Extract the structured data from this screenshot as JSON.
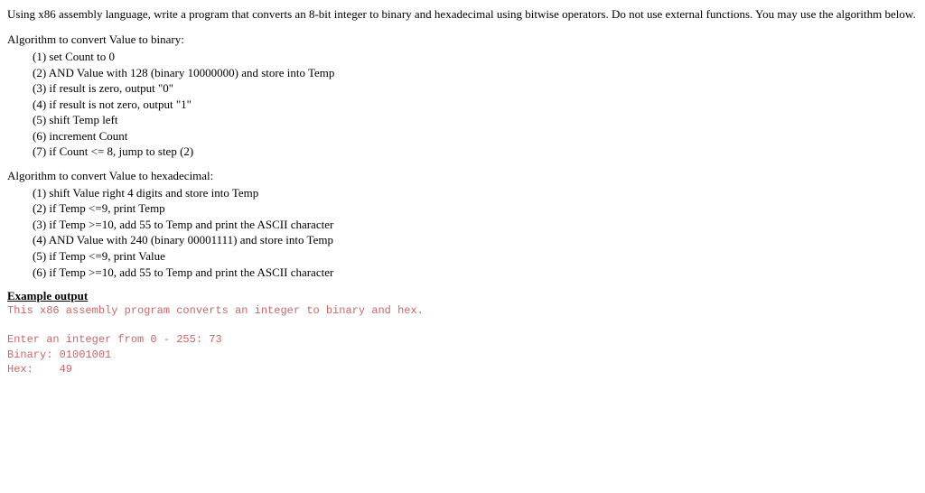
{
  "intro": "Using x86 assembly language, write a program that converts an 8-bit integer to binary and hexadecimal using bitwise operators.  Do not use external functions.  You may use the algorithm below.",
  "binary_algo_title": "Algorithm to convert Value to binary:",
  "binary_steps": [
    "(1)  set Count to 0",
    "(2)  AND Value with 128 (binary 10000000) and store into Temp",
    "(3)  if result is zero, output \"0\"",
    "(4)  if result is not zero, output \"1\"",
    "(5)  shift Temp left",
    "(6)  increment Count",
    "(7)  if Count <= 8, jump to step (2)"
  ],
  "hex_algo_title": "Algorithm to convert Value to hexadecimal:",
  "hex_steps": [
    "(1)  shift Value right 4 digits and store into Temp",
    "(2)  if Temp <=9, print Temp",
    "(3)  if Temp >=10, add 55 to Temp and print the ASCII character",
    "(4)  AND Value with 240 (binary 00001111) and store into Temp",
    "(5)  if Temp <=9, print Value",
    "(6)  if Temp >=10, add 55 to Temp and print the ASCII character"
  ],
  "example_heading": "Example output",
  "console_lines": [
    "This x86 assembly program converts an integer to binary and hex.",
    "",
    "Enter an integer from 0 - 255: 73",
    "Binary: 01001001",
    "Hex:    49"
  ]
}
